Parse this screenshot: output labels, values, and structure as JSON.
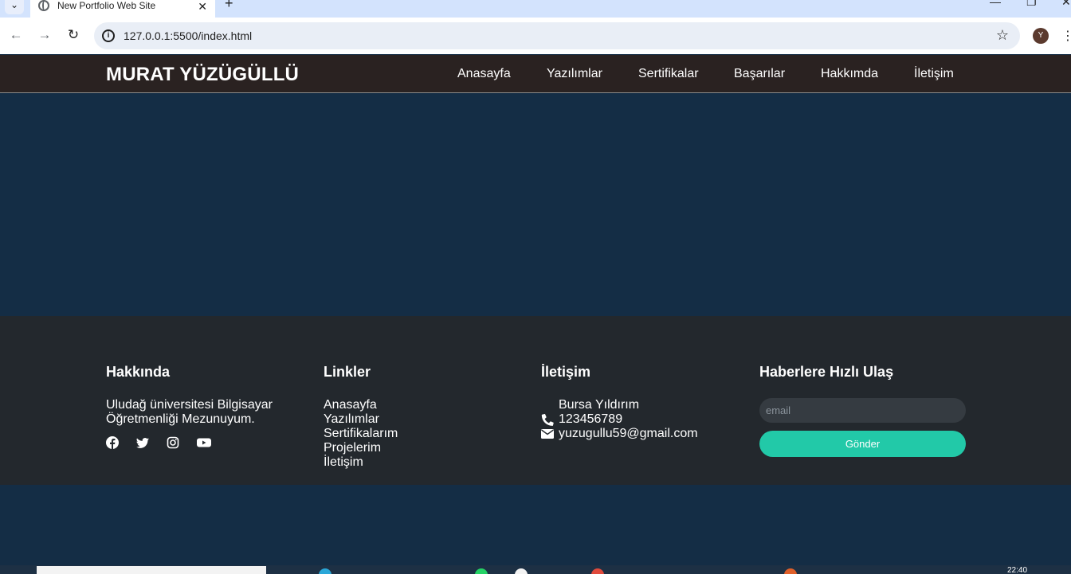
{
  "browser": {
    "tab_title": "New Portfolio Web Site",
    "url": "127.0.0.1:5500/index.html",
    "profile_initial": "Y"
  },
  "header": {
    "brand": "MURAT YÜZÜGÜLLÜ",
    "nav": [
      "Anasayfa",
      "Yazılımlar",
      "Sertifikalar",
      "Başarılar",
      "Hakkımda",
      "İletişim"
    ]
  },
  "footer": {
    "about": {
      "title": "Hakkında",
      "text_line1": "Uludağ üniversitesi Bilgisayar",
      "text_line2": "Öğretmenliği Mezunuyum.",
      "socials": [
        "facebook-icon",
        "twitter-icon",
        "instagram-icon",
        "youtube-icon"
      ]
    },
    "links": {
      "title": "Linkler",
      "items": [
        "Anasayfa",
        "Yazılımlar",
        "Sertifikalarım",
        "Projelerim",
        "İletişim"
      ]
    },
    "contact": {
      "title": "İletişim",
      "address": "Bursa Yıldırım",
      "phone": "123456789",
      "email": "yuzugullu59@gmail.com"
    },
    "newsletter": {
      "title": "Haberlere Hızlı Ulaş",
      "email_placeholder": "email",
      "button_label": "Gönder"
    }
  },
  "taskbar": {
    "time": "22:40"
  },
  "colors": {
    "header_bg": "#2a2221",
    "page_bg": "#142d45",
    "footer_bg": "#23282d",
    "accent": "#22c9a8"
  }
}
